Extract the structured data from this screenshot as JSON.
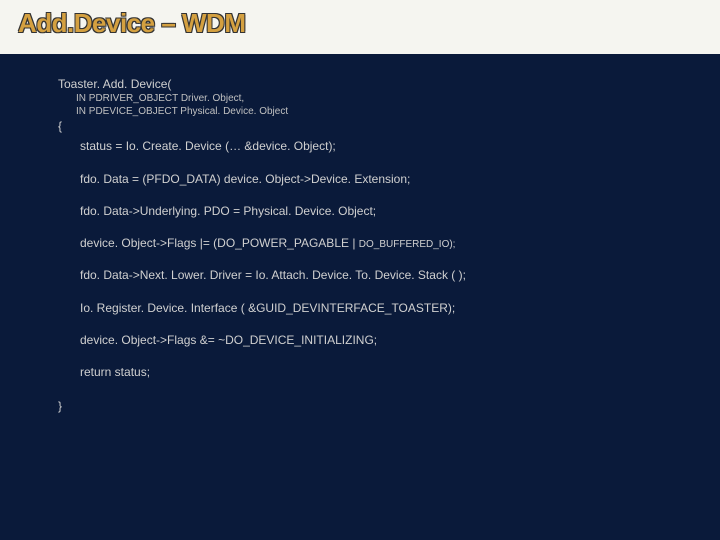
{
  "title": "Add.Device – WDM",
  "func_name": "Toaster. Add. Device(",
  "param1": "IN PDRIVER_OBJECT Driver. Object,",
  "param2": "IN PDEVICE_OBJECT Physical. Device. Object",
  "open_brace": "{",
  "line1": "status = Io. Create. Device (… &device. Object);",
  "line2": "fdo. Data = (PFDO_DATA) device. Object->Device. Extension;",
  "line3": "fdo. Data->Underlying. PDO = Physical. Device. Object;",
  "line4_a": "device. Object->Flags |= (DO_POWER_PAGABLE | ",
  "line4_b": "DO_BUFFERED_IO);",
  "line5": "fdo. Data->Next. Lower. Driver = Io. Attach. Device. To. Device. Stack ( );",
  "line6": "Io. Register. Device. Interface ( &GUID_DEVINTERFACE_TOASTER);",
  "line7": "device. Object->Flags &= ~DO_DEVICE_INITIALIZING;",
  "line8": "return status;",
  "close_brace": "}"
}
